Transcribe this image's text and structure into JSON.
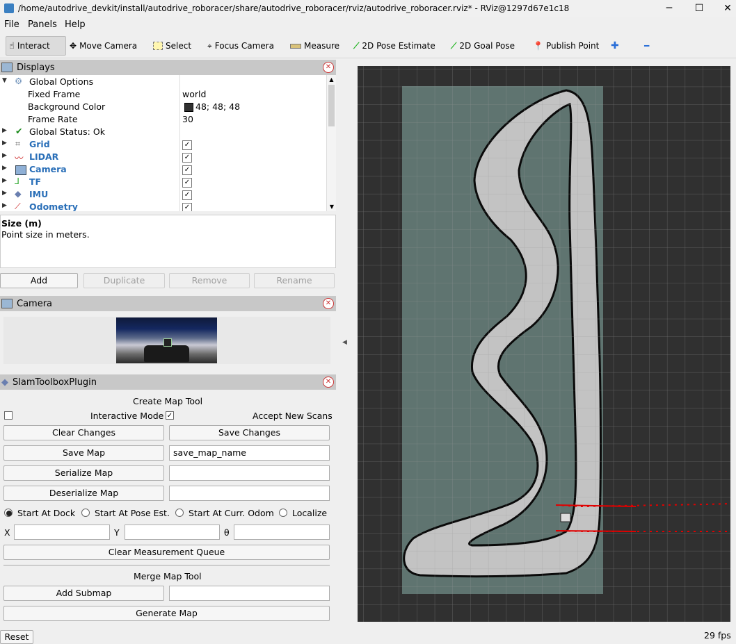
{
  "window": {
    "title": "/home/autodrive_devkit/install/autodrive_roboracer/share/autodrive_roboracer/rviz/autodrive_roboracer.rviz* - RViz@1297d67e1c18",
    "minimize": "─",
    "maximize": "☐",
    "close": "✕"
  },
  "menu": [
    "File",
    "Panels",
    "Help"
  ],
  "toolbar": {
    "interact": "Interact",
    "move_camera": "Move Camera",
    "select": "Select",
    "focus_camera": "Focus Camera",
    "measure": "Measure",
    "pose_estimate": "2D Pose Estimate",
    "goal_pose": "2D Goal Pose",
    "publish_point": "Publish Point",
    "plus": "✚",
    "minus": "━"
  },
  "displays": {
    "title": "Displays",
    "rows": [
      {
        "label": "Global Options",
        "value": ""
      },
      {
        "label": "Fixed Frame",
        "value": "world"
      },
      {
        "label": "Background Color",
        "value": "48; 48; 48"
      },
      {
        "label": "Frame Rate",
        "value": "30"
      },
      {
        "label": "Global Status: Ok",
        "value": ""
      },
      {
        "label": "Grid",
        "value": "✓"
      },
      {
        "label": "LIDAR",
        "value": "✓"
      },
      {
        "label": "Camera",
        "value": "✓"
      },
      {
        "label": "TF",
        "value": "✓"
      },
      {
        "label": "IMU",
        "value": "✓"
      },
      {
        "label": "Odometry",
        "value": "✓"
      }
    ],
    "desc_title": "Size (m)",
    "desc_text": "Point size in meters.",
    "buttons": {
      "add": "Add",
      "duplicate": "Duplicate",
      "remove": "Remove",
      "rename": "Rename"
    }
  },
  "camera_panel": {
    "title": "Camera"
  },
  "slam": {
    "title": "SlamToolboxPlugin",
    "create_title": "Create Map Tool",
    "interactive_mode": "Interactive Mode",
    "accept_new_scans": "Accept New Scans",
    "clear_changes": "Clear Changes",
    "save_changes": "Save Changes",
    "save_map": "Save Map",
    "save_map_name": "save_map_name",
    "serialize_map": "Serialize Map",
    "deserialize_map": "Deserialize Map",
    "start_at_dock": "Start At Dock",
    "start_at_pose": "Start At Pose Est.",
    "start_at_odom": "Start At Curr. Odom",
    "localize": "Localize",
    "x": "X",
    "y": "Y",
    "theta": "θ",
    "clear_queue": "Clear Measurement Queue",
    "merge_title": "Merge Map Tool",
    "add_submap": "Add Submap",
    "generate_map": "Generate Map"
  },
  "status": {
    "reset": "Reset",
    "fps": "29 fps"
  }
}
